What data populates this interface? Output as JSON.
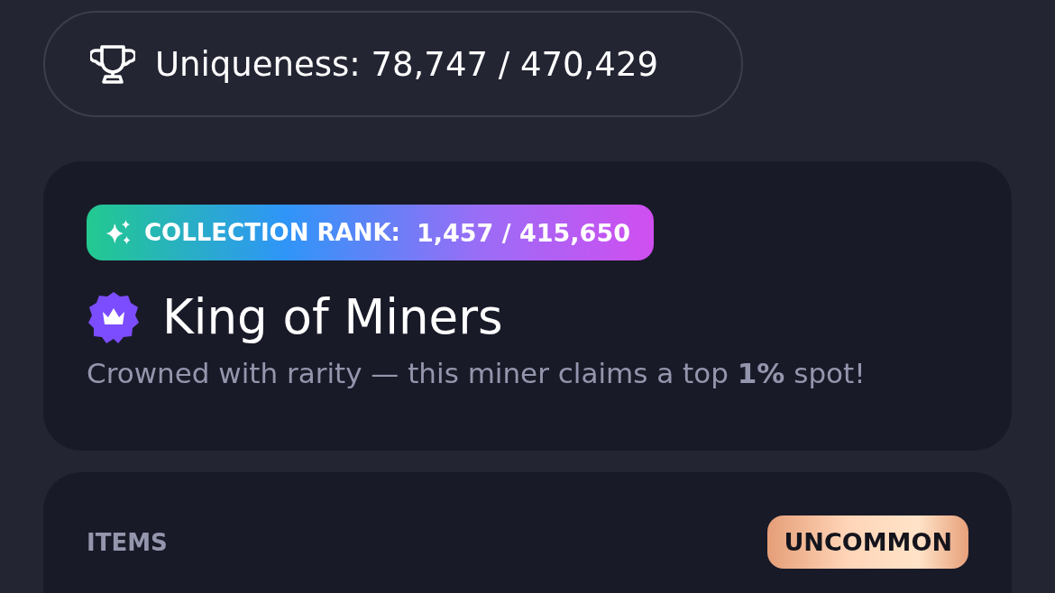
{
  "uniqueness": {
    "text": "Uniqueness: 78,747 / 470,429"
  },
  "rank_card": {
    "rank_label": "COLLECTION RANK:",
    "rank_value": "1,457 / 415,650",
    "title": "King of Miners",
    "subtitle": "Crowned with rarity — this miner claims a top **1%** spot!"
  },
  "items_card": {
    "heading": "ITEMS",
    "rarity": {
      "label": "UNCOMMON",
      "kind": "uncommon"
    }
  }
}
